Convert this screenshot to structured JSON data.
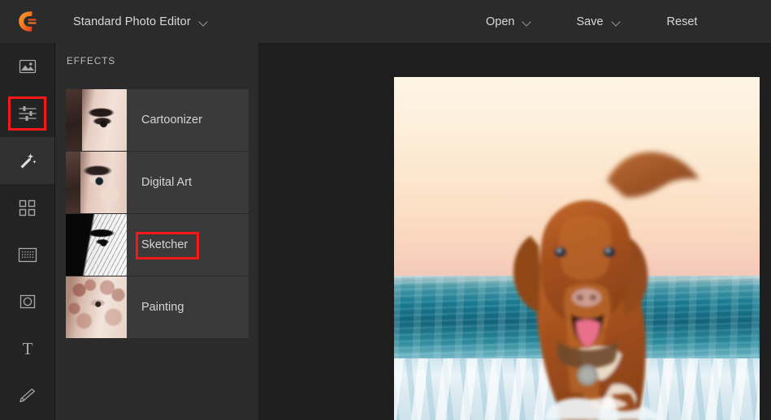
{
  "app": {
    "logo_icon": "cyberlink-c-logo-icon",
    "title": "Standard Photo Editor",
    "title_dropdown_icon": "chevron-down-icon"
  },
  "header": {
    "actions": [
      {
        "label": "Open",
        "icon": "chevron-down-icon",
        "has_dropdown": true
      },
      {
        "label": "Save",
        "icon": "chevron-down-icon",
        "has_dropdown": true
      },
      {
        "label": "Reset",
        "icon": "",
        "has_dropdown": false
      }
    ]
  },
  "sidebar": {
    "items": [
      {
        "name": "image-tool",
        "icon": "image-icon",
        "selected": false
      },
      {
        "name": "adjust-tool",
        "icon": "sliders-icon",
        "selected": false
      },
      {
        "name": "effects-tool",
        "icon": "magic-wand-icon",
        "selected": true
      },
      {
        "name": "frames-tool",
        "icon": "grid-icon",
        "selected": false
      },
      {
        "name": "texture-tool",
        "icon": "texture-icon",
        "selected": false
      },
      {
        "name": "vignette-tool",
        "icon": "vignette-icon",
        "selected": false
      },
      {
        "name": "text-tool",
        "icon": "text-t-icon",
        "selected": false
      },
      {
        "name": "draw-tool",
        "icon": "pencil-icon",
        "selected": false
      }
    ]
  },
  "panel": {
    "title": "EFFECTS",
    "effects": [
      {
        "label": "Cartoonizer",
        "thumb": "cartoonizer-thumbnail",
        "highlighted": false
      },
      {
        "label": "Digital Art",
        "thumb": "digital-art-thumbnail",
        "highlighted": false
      },
      {
        "label": "Sketcher",
        "thumb": "sketcher-thumbnail",
        "highlighted": true
      },
      {
        "label": "Painting",
        "thumb": "painting-thumbnail",
        "highlighted": false
      }
    ]
  },
  "canvas": {
    "photo_alt": "Brown Nova Scotia duck tolling retriever running through ocean surf at sunset"
  },
  "annotations": [
    {
      "name": "effects-tool-highlight",
      "color": "#f81818"
    },
    {
      "name": "sketcher-label-highlight",
      "color": "#f81818"
    }
  ],
  "colors": {
    "header_bg": "#2b2b2b",
    "rail_bg": "#232323",
    "panel_bg": "#2b2b2b",
    "effect_item_bg": "#3a3a3a",
    "canvas_bg": "#1e1e1e",
    "text": "#d8d8d8",
    "annotation_red": "#f81818",
    "logo_orange": "#f07c28"
  }
}
